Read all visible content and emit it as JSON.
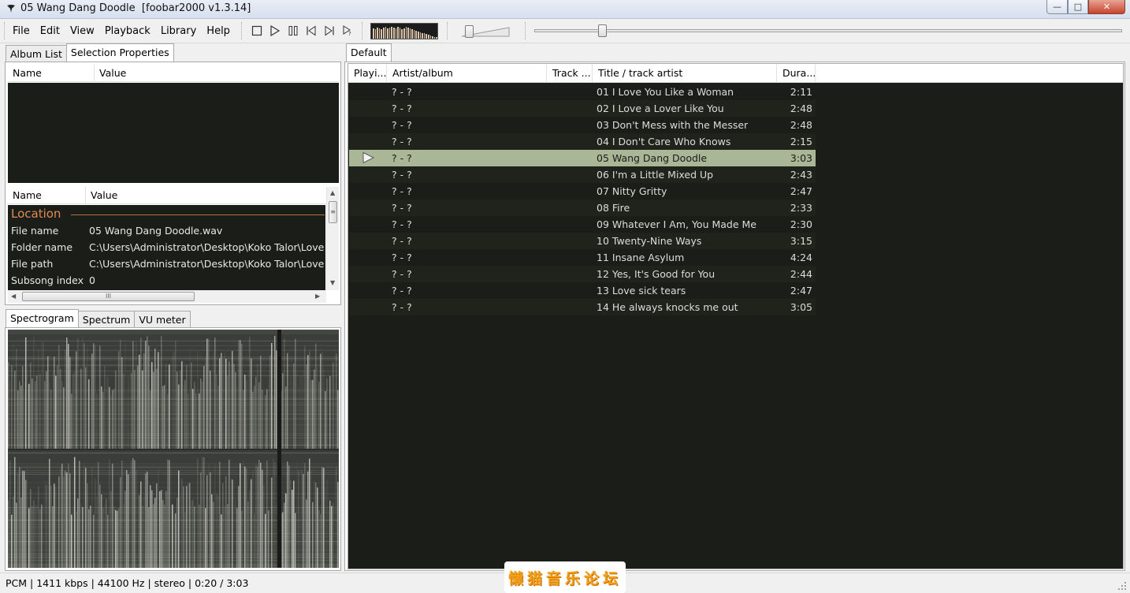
{
  "window": {
    "title": "05 Wang Dang Doodle  [foobar2000 v1.3.14]",
    "controls": {
      "minimize": "—",
      "maximize": "□",
      "close": "✕"
    }
  },
  "menu": [
    "File",
    "Edit",
    "View",
    "Playback",
    "Library",
    "Help"
  ],
  "transport": [
    "stop-icon",
    "play-icon",
    "pause-icon",
    "previous-icon",
    "next-icon",
    "random-icon"
  ],
  "left_tabs": [
    "Album List",
    "Selection Properties"
  ],
  "top_list": {
    "headers": [
      "Name",
      "Value"
    ]
  },
  "properties": {
    "headers": [
      "Name",
      "Value"
    ],
    "group": "Location",
    "rows": [
      {
        "name": "File name",
        "value": "05 Wang Dang Doodle.wav"
      },
      {
        "name": "Folder name",
        "value": "C:\\Users\\Administrator\\Desktop\\Koko Talor\\Love Y"
      },
      {
        "name": "File path",
        "value": "C:\\Users\\Administrator\\Desktop\\Koko Talor\\Love Y"
      },
      {
        "name": "Subsong index",
        "value": "0"
      }
    ],
    "hscroll_grip": "III",
    "vscroll_grip": "≡"
  },
  "viz_tabs": [
    "Spectrogram",
    "Spectrum",
    "VU meter"
  ],
  "playlist_tabs": [
    "Default"
  ],
  "playlist": {
    "headers": [
      "Playi...",
      "Artist/album",
      "Track ...",
      "Title / track artist",
      "Dura..."
    ],
    "playing_index": 4,
    "rows": [
      {
        "artist": "? - ?",
        "title": "01 I Love You Like a Woman",
        "duration": "2:11"
      },
      {
        "artist": "? - ?",
        "title": "02 I Love a Lover Like You",
        "duration": "2:48"
      },
      {
        "artist": "? - ?",
        "title": "03 Don't Mess with the Messer",
        "duration": "2:48"
      },
      {
        "artist": "? - ?",
        "title": "04 I Don't Care Who Knows",
        "duration": "2:15"
      },
      {
        "artist": "? - ?",
        "title": "05 Wang Dang Doodle",
        "duration": "3:03"
      },
      {
        "artist": "? - ?",
        "title": "06 I'm a Little Mixed Up",
        "duration": "2:43"
      },
      {
        "artist": "? - ?",
        "title": "07 Nitty Gritty",
        "duration": "2:47"
      },
      {
        "artist": "? - ?",
        "title": "08 Fire",
        "duration": "2:33"
      },
      {
        "artist": "? - ?",
        "title": "09 Whatever I Am, You Made Me",
        "duration": "2:30"
      },
      {
        "artist": "? - ?",
        "title": "10 Twenty-Nine Ways",
        "duration": "3:15"
      },
      {
        "artist": "? - ?",
        "title": "11 Insane Asylum",
        "duration": "4:24"
      },
      {
        "artist": "? - ?",
        "title": "12 Yes, It's Good for You",
        "duration": "2:44"
      },
      {
        "artist": "? - ?",
        "title": "13 Love sick tears",
        "duration": "2:47"
      },
      {
        "artist": "? - ?",
        "title": "14 He always knocks me out",
        "duration": "3:05"
      }
    ]
  },
  "seek_position": 0.11,
  "volume_position": 0.12,
  "status": "PCM | 1411 kbps | 44100 Hz | stereo | 0:20 / 3:03",
  "watermark": "懒猫音乐论坛",
  "colors": {
    "panel_bg": "#1b1e18",
    "selected_row": "#a9b796",
    "group_accent": "#e08a54"
  }
}
